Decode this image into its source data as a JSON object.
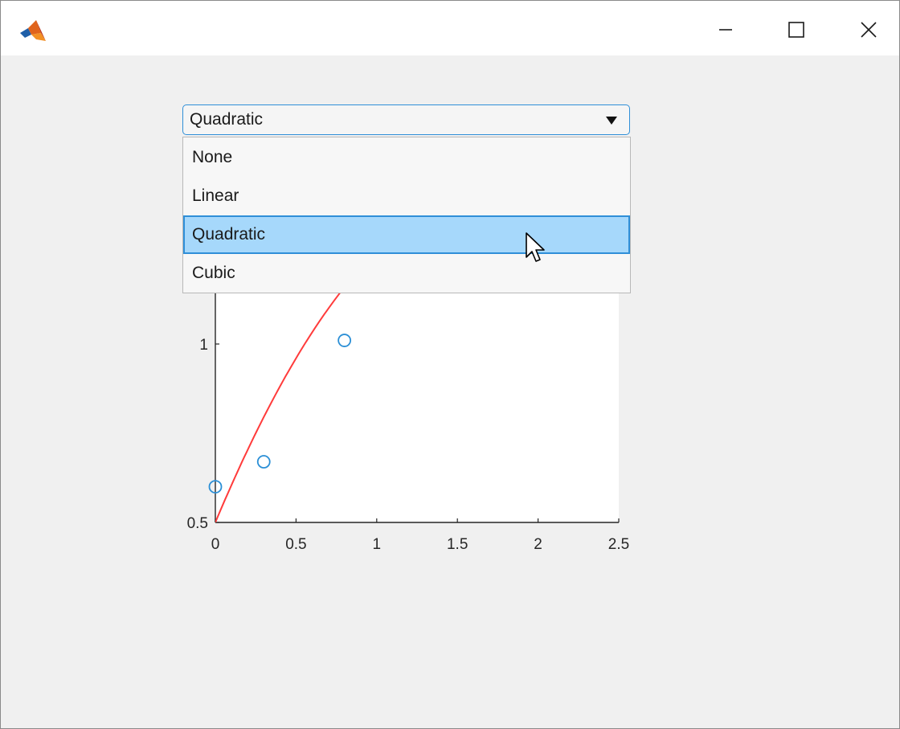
{
  "window": {
    "controls": {
      "minimize_icon": "minimize-icon",
      "maximize_icon": "maximize-icon",
      "close_icon": "close-icon"
    }
  },
  "dropdown": {
    "selected_value": "Quadratic",
    "options": [
      "None",
      "Linear",
      "Quadratic",
      "Cubic"
    ],
    "selected_index": 2,
    "accent_color": "#2f8fd8",
    "highlight_color": "#a6d8fb"
  },
  "chart_data": {
    "type": "scatter",
    "xlim": [
      0,
      2.5
    ],
    "ylim": [
      0.5,
      1.15
    ],
    "x_ticks": [
      "0",
      "0.5",
      "1",
      "1.5",
      "2",
      "2.5"
    ],
    "y_ticks": [
      "0.5",
      "1"
    ],
    "points": [
      {
        "x": 0,
        "y": 0.6
      },
      {
        "x": 0.3,
        "y": 0.67
      },
      {
        "x": 0.8,
        "y": 1.01
      }
    ],
    "fit_curve": {
      "name": "Quadratic",
      "color": "#ff3b3b",
      "coefficients": [
        0.5,
        1.08,
        -0.32
      ]
    },
    "marker_color": "#2b8fd6",
    "grid": false
  }
}
